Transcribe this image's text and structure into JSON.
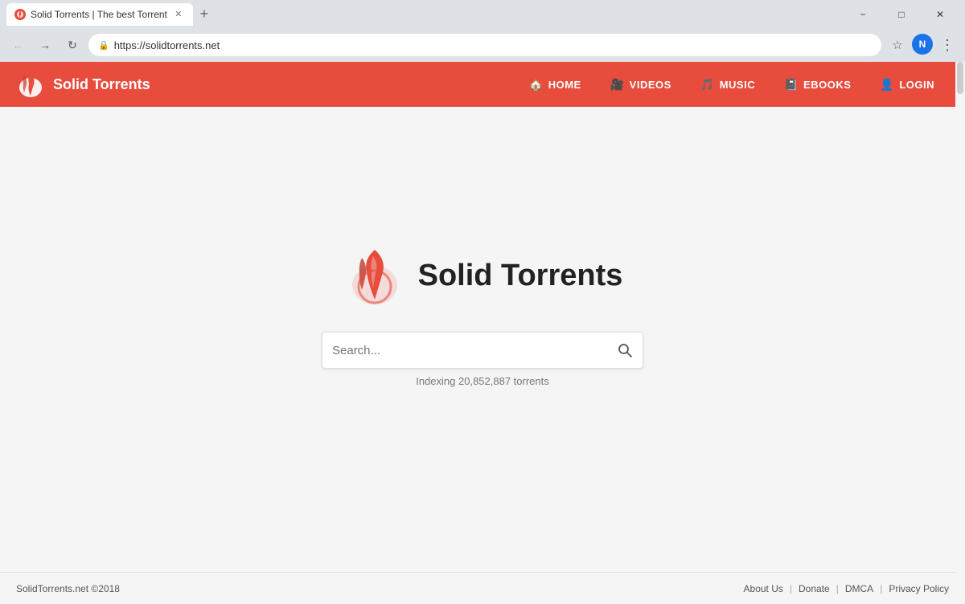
{
  "browser": {
    "tab_title": "Solid Torrents | The best Torrent",
    "url": "https://solidtorrents.net",
    "user_initial": "N"
  },
  "site": {
    "title": "Solid Torrents",
    "logo_alt": "Solid Torrents Logo"
  },
  "nav": {
    "home": "HOME",
    "videos": "VIDEOS",
    "music": "MUSIC",
    "ebooks": "EBOOKS",
    "login": "LOGIN"
  },
  "hero": {
    "logo_text": "Solid Torrents",
    "search_placeholder": "Search...",
    "indexing_text": "Indexing 20,852,887 torrents"
  },
  "footer": {
    "copyright": "SolidTorrents.net ©2018",
    "about_us": "About Us",
    "donate": "Donate",
    "dmca": "DMCA",
    "privacy_policy": "Privacy Policy"
  }
}
